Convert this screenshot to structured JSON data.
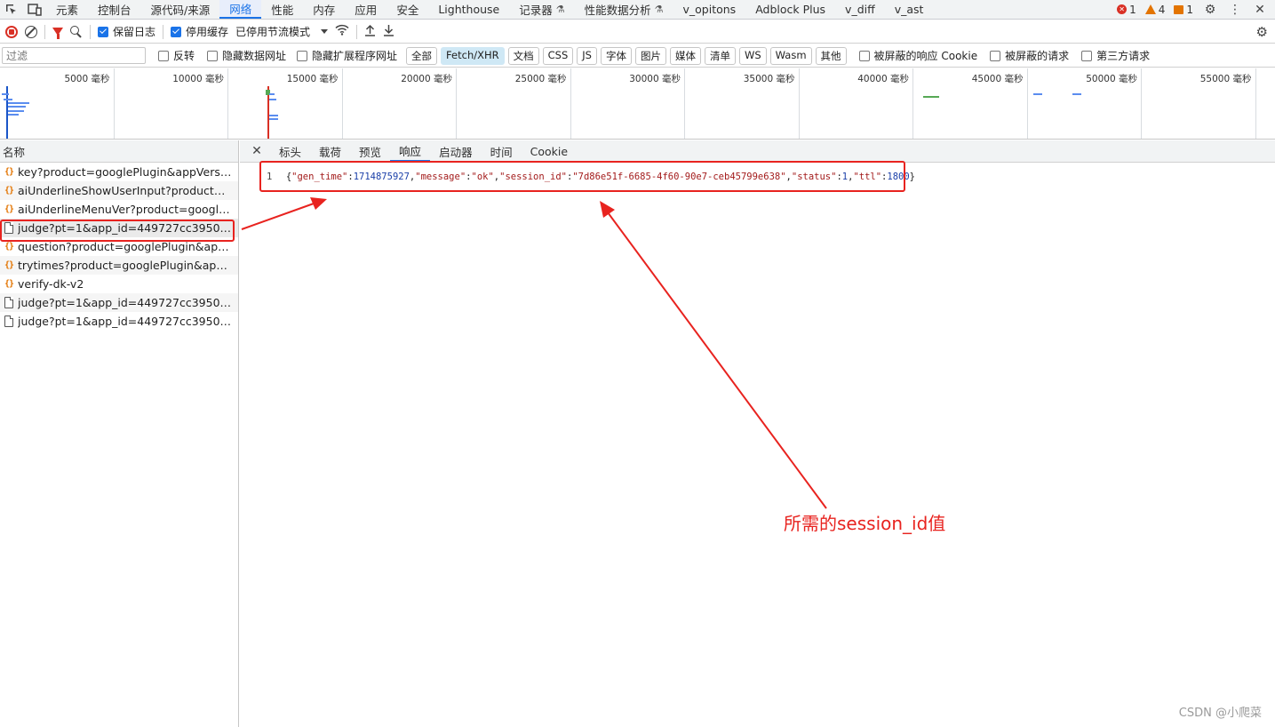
{
  "tabs": [
    "元素",
    "控制台",
    "源代码/来源",
    "网络",
    "性能",
    "内存",
    "应用",
    "安全",
    "Lighthouse",
    "记录器",
    "性能数据分析",
    "v_opitons",
    "Adblock Plus",
    "v_diff",
    "v_ast"
  ],
  "active_tab": "网络",
  "flask_symbol": "⚗",
  "status": {
    "errors": "1",
    "warnings": "4",
    "issues": "1"
  },
  "toolbar": {
    "preserve_log": "保留日志",
    "disable_cache": "停用缓存",
    "throttle": "已停用节流模式"
  },
  "filter": {
    "placeholder": "过滤",
    "invert": "反转",
    "hide_data_urls": "隐藏数据网址",
    "hide_extension_urls": "隐藏扩展程序网址",
    "types": [
      "全部",
      "Fetch/XHR",
      "文档",
      "CSS",
      "JS",
      "字体",
      "图片",
      "媒体",
      "清单",
      "WS",
      "Wasm",
      "其他"
    ],
    "active_type": "Fetch/XHR",
    "blocked_cookies": "被屏蔽的响应 Cookie",
    "blocked_requests": "被屏蔽的请求",
    "third_party": "第三方请求"
  },
  "overview": {
    "ticks": [
      "5000 毫秒",
      "10000 毫秒",
      "15000 毫秒",
      "20000 毫秒",
      "25000 毫秒",
      "30000 毫秒",
      "35000 毫秒",
      "40000 毫秒",
      "45000 毫秒",
      "50000 毫秒",
      "55000 毫秒"
    ]
  },
  "list": {
    "header": "名称",
    "rows": [
      {
        "name": "key?product=googlePlugin&appVersion...",
        "type": "xhr"
      },
      {
        "name": "aiUnderlineShowUserInput?product=go...",
        "type": "xhr"
      },
      {
        "name": "aiUnderlineMenuVer?product=googlePl...",
        "type": "xhr"
      },
      {
        "name": "judge?pt=1&app_id=449727cc395032a...",
        "type": "doc"
      },
      {
        "name": "question?product=googlePlugin&appVe...",
        "type": "xhr"
      },
      {
        "name": "trytimes?product=googlePlugin&appVe...",
        "type": "xhr"
      },
      {
        "name": "verify-dk-v2",
        "type": "xhr"
      },
      {
        "name": "judge?pt=1&app_id=449727cc395032a...",
        "type": "doc"
      },
      {
        "name": "judge?pt=1&app_id=449727cc395032a...",
        "type": "doc"
      }
    ]
  },
  "detail": {
    "tabs": [
      "标头",
      "载荷",
      "预览",
      "响应",
      "启动器",
      "时间",
      "Cookie"
    ],
    "active_tab": "响应",
    "line_number": "1",
    "response": {
      "gen_time": "1714875927",
      "message": "ok",
      "session_id": "7d86e51f-6685-4f60-90e7-ceb45799e638",
      "status": "1",
      "ttl": "1800"
    }
  },
  "annotation": "所需的session_id值",
  "watermark": "CSDN @小爬菜",
  "colors": {
    "accent": "#1a73e8",
    "annotation_red": "#e8231f",
    "error": "#d93025",
    "warning": "#e37400"
  }
}
